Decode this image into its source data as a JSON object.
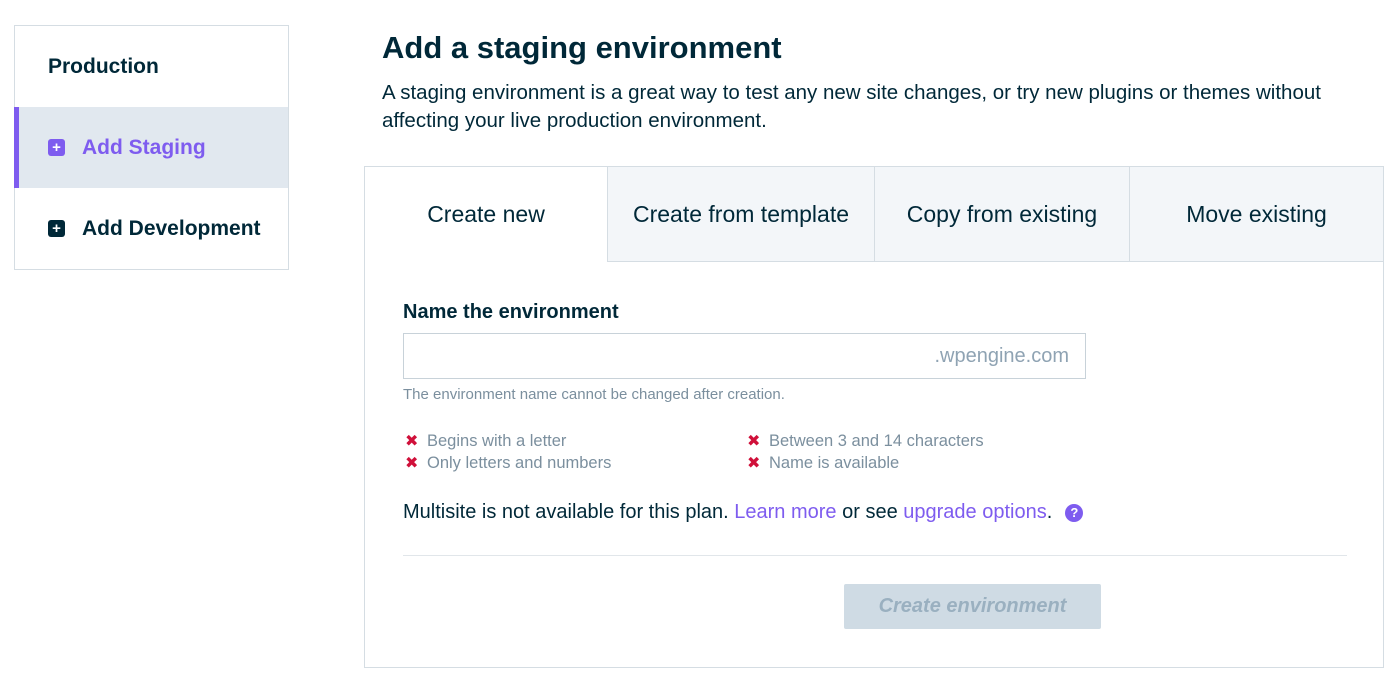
{
  "sidebar": {
    "items": [
      {
        "label": "Production",
        "icon": "none"
      },
      {
        "label": "Add Staging",
        "icon": "plus-square-icon",
        "active": true
      },
      {
        "label": "Add Development",
        "icon": "plus-square-icon"
      }
    ]
  },
  "header": {
    "title": "Add a staging environment",
    "subtitle": "A staging environment is a great way to test any new site changes, or try new plugins or themes without affecting your live production environment."
  },
  "tabs": [
    {
      "label": "Create new",
      "active": true
    },
    {
      "label": "Create from template"
    },
    {
      "label": "Copy from existing"
    },
    {
      "label": "Move existing"
    }
  ],
  "form": {
    "field_label": "Name the environment",
    "input_value": "",
    "input_suffix": ".wpengine.com",
    "help_text": "The environment name cannot be changed after creation.",
    "rules": [
      "Begins with a letter",
      "Between 3 and 14 characters",
      "Only letters and numbers",
      "Name is available"
    ],
    "multisite": {
      "text_before": "Multisite is not available for this plan.",
      "learn_more": "Learn more",
      "text_middle": "or see",
      "upgrade": "upgrade options",
      "text_after": "."
    },
    "submit_label": "Create environment"
  },
  "colors": {
    "accent": "#7e5cef",
    "text": "#002838",
    "error": "#d0103a",
    "muted": "#7b8f9e",
    "disabled_button": "#cfdbe4"
  }
}
